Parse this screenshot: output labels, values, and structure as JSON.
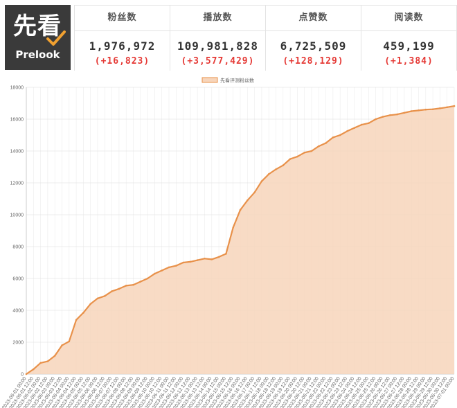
{
  "logo": {
    "main": "先看",
    "sub": "Prelook"
  },
  "stats": [
    {
      "label": "粉丝数",
      "value": "1,976,972",
      "delta": "(+16,823)"
    },
    {
      "label": "播放数",
      "value": "109,981,828",
      "delta": "(+3,577,429)"
    },
    {
      "label": "点赞数",
      "value": "6,725,509",
      "delta": "(+128,129)"
    },
    {
      "label": "阅读数",
      "value": "459,199",
      "delta": "(+1,384)"
    }
  ],
  "colors": {
    "line": "#e8914a",
    "fill": "#f7d5bb",
    "delta": "#e53935",
    "logo_bg": "#3a3a3a"
  },
  "chart_data": {
    "type": "area",
    "legend": {
      "position": "top-center"
    },
    "series": [
      {
        "name": "先看评测粉丝数",
        "x": [
          "2023-06-01 00:00",
          "2023-06-01 12:00",
          "2023-06-02 00:00",
          "2023-06-02 12:00",
          "2023-06-03 00:00",
          "2023-06-03 12:00",
          "2023-06-04 00:00",
          "2023-06-04 12:00",
          "2023-06-05 00:00",
          "2023-06-05 12:00",
          "2023-06-06 00:00",
          "2023-06-06 12:00",
          "2023-06-07 00:00",
          "2023-06-07 12:00",
          "2023-06-08 00:00",
          "2023-06-08 12:00",
          "2023-06-09 00:00",
          "2023-06-09 12:00",
          "2023-06-10 00:00",
          "2023-06-10 12:00",
          "2023-06-11 00:00",
          "2023-06-11 12:00",
          "2023-06-12 00:00",
          "2023-06-12 12:00",
          "2023-06-13 00:00",
          "2023-06-13 12:00",
          "2023-06-14 00:00",
          "2023-06-14 12:00",
          "2023-06-15 00:00",
          "2023-06-15 12:00",
          "2023-06-16 00:00",
          "2023-06-16 12:00",
          "2023-06-17 00:00",
          "2023-06-17 12:00",
          "2023-06-18 00:00",
          "2023-06-18 12:00",
          "2023-06-19 00:00",
          "2023-06-19 12:00",
          "2023-06-20 00:00",
          "2023-06-20 12:00",
          "2023-06-21 00:00",
          "2023-06-21 12:00",
          "2023-06-22 00:00",
          "2023-06-22 12:00",
          "2023-06-23 00:00",
          "2023-06-23 12:00",
          "2023-06-24 00:00",
          "2023-06-24 12:00",
          "2023-06-25 00:00",
          "2023-06-25 12:00",
          "2023-06-26 00:00",
          "2023-06-26 12:00",
          "2023-06-27 00:00",
          "2023-06-27 12:00",
          "2023-06-28 00:00",
          "2023-06-28 12:00",
          "2023-06-29 00:00",
          "2023-06-29 12:00",
          "2023-06-30 00:00",
          "2023-06-30 12:00",
          "2023-07-01 00:00"
        ],
        "values": [
          0,
          300,
          700,
          800,
          1150,
          1800,
          2050,
          3400,
          3850,
          4400,
          4750,
          4900,
          5200,
          5350,
          5550,
          5600,
          5800,
          6000,
          6300,
          6500,
          6700,
          6800,
          7000,
          7050,
          7150,
          7250,
          7200,
          7350,
          7550,
          9200,
          10300,
          10900,
          11400,
          12100,
          12550,
          12850,
          13100,
          13500,
          13650,
          13900,
          14000,
          14300,
          14500,
          14850,
          15000,
          15250,
          15450,
          15650,
          15750,
          16000,
          16150,
          16250,
          16300,
          16400,
          16500,
          16550,
          16600,
          16620,
          16680,
          16750,
          16823
        ]
      }
    ],
    "y_ticks": [
      "0",
      "2000",
      "4000",
      "6000",
      "8000",
      "10000",
      "12000",
      "14000",
      "16000",
      "18000"
    ],
    "ylim": [
      0,
      18000
    ],
    "grid": true
  }
}
